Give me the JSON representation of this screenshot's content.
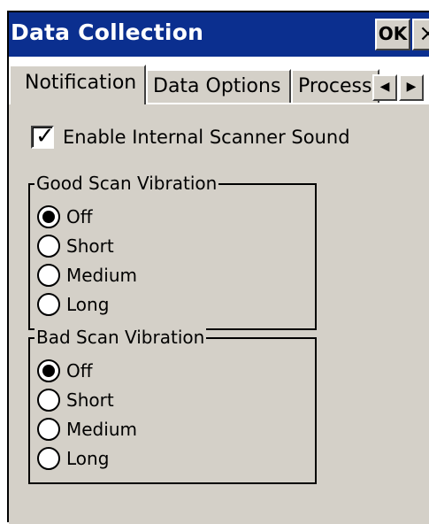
{
  "window": {
    "title": "Data Collection",
    "ok_label": "OK",
    "close_label": "×"
  },
  "tabs": [
    {
      "label": "Notification",
      "active": true
    },
    {
      "label": "Data Options",
      "active": false
    },
    {
      "label": "Processi",
      "active": false
    }
  ],
  "tab_scroll": {
    "left_icon": "◀",
    "right_icon": "▶"
  },
  "enable_sound": {
    "label": "Enable Internal Scanner Sound",
    "checked": true,
    "check_glyph": "✓"
  },
  "good_scan": {
    "title": "Good Scan Vibration",
    "options": [
      "Off",
      "Short",
      "Medium",
      "Long"
    ],
    "selected": "Off"
  },
  "bad_scan": {
    "title": "Bad Scan Vibration",
    "options": [
      "Off",
      "Short",
      "Medium",
      "Long"
    ],
    "selected": "Off"
  },
  "colors": {
    "titlebar": "#0b2f8f",
    "panel": "#d4d0c8"
  }
}
